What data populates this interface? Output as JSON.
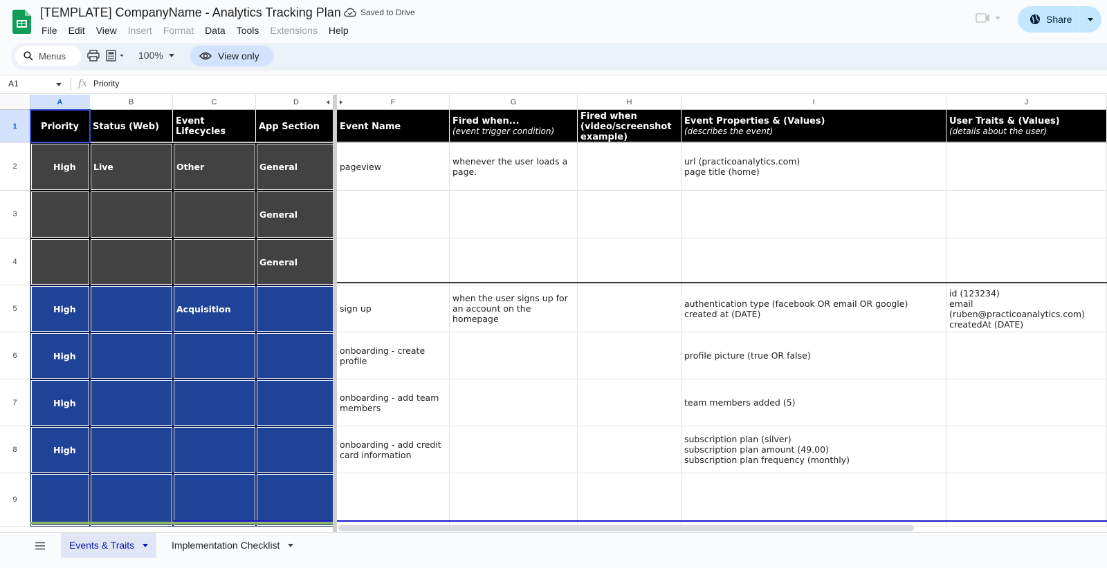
{
  "app": {
    "title": "[TEMPLATE] CompanyName - Analytics Tracking Plan",
    "save_status": "Saved to Drive",
    "brand_color": "#0f9d58"
  },
  "menu": [
    "File",
    "Edit",
    "View",
    "Insert",
    "Format",
    "Data",
    "Tools",
    "Extensions",
    "Help"
  ],
  "menu_disabled": [
    "Insert",
    "Format",
    "Extensions"
  ],
  "share": {
    "label": "Share",
    "color": "#c2e7ff"
  },
  "toolbar": {
    "search_label": "Menus",
    "zoom": "100%",
    "mode_label": "View only"
  },
  "formula_bar": {
    "cell_ref": "A1",
    "fx": "fx",
    "value": "Priority"
  },
  "columns": [
    "A",
    "B",
    "C",
    "D",
    "F",
    "G",
    "H",
    "I",
    "J"
  ],
  "rows": [
    "1",
    "2",
    "3",
    "4",
    "5",
    "6",
    "7",
    "8",
    "9"
  ],
  "header": {
    "priority": "Priority",
    "status": "Status (Web)",
    "lifecycle": "Event Lifecycles",
    "app_section": "App Section",
    "event_name": "Event Name",
    "fired_when": "Fired when...",
    "fired_when_sub": "(event trigger condition)",
    "fired_when_video": "Fired when (video/screenshot example)",
    "event_props": "Event Properties & (Values)",
    "event_props_sub": "(describes the event)",
    "user_traits": "User Traits & (Values)",
    "user_traits_sub": "(details about the user)"
  },
  "data_rows": [
    {
      "row": "2",
      "style": "dark",
      "priority": "High",
      "status": "Live",
      "lifecycle": "Other",
      "app_section": "General",
      "event_name": "pageview",
      "fired_when": "whenever the user loads a page.",
      "video": "",
      "props": "url (practicoanalytics.com)\npage title (home)",
      "traits": ""
    },
    {
      "row": "3",
      "style": "dark",
      "priority": "",
      "status": "",
      "lifecycle": "",
      "app_section": "General",
      "event_name": "",
      "fired_when": "",
      "video": "",
      "props": "",
      "traits": ""
    },
    {
      "row": "4",
      "style": "dark",
      "priority": "",
      "status": "",
      "lifecycle": "",
      "app_section": "General",
      "event_name": "",
      "fired_when": "",
      "video": "",
      "props": "",
      "traits": ""
    },
    {
      "row": "5",
      "style": "blue",
      "priority": "High",
      "status": "",
      "lifecycle": "Acquisition",
      "app_section": "",
      "event_name": "sign up",
      "fired_when": "when the user signs up for an account on the homepage",
      "video": "",
      "props": "authentication type (facebook OR email OR google)\ncreated at (DATE)",
      "traits": "id (123234)\nemail (ruben@practicoanalytics.com)\ncreatedAt (DATE)"
    },
    {
      "row": "6",
      "style": "blue",
      "priority": "High",
      "status": "",
      "lifecycle": "",
      "app_section": "",
      "event_name": "onboarding - create profile",
      "fired_when": "",
      "video": "",
      "props": "profile picture (true OR false)",
      "traits": ""
    },
    {
      "row": "7",
      "style": "blue",
      "priority": "High",
      "status": "",
      "lifecycle": "",
      "app_section": "",
      "event_name": "onboarding - add team members",
      "fired_when": "",
      "video": "",
      "props": "team members added (5)",
      "traits": ""
    },
    {
      "row": "8",
      "style": "blue",
      "priority": "High",
      "status": "",
      "lifecycle": "",
      "app_section": "",
      "event_name": "onboarding - add credit card information",
      "fired_when": "",
      "video": "",
      "props": "subscription plan (silver)\nsubscription plan amount (49.00)\nsubscription plan frequency (monthly)",
      "traits": ""
    },
    {
      "row": "9",
      "style": "blue",
      "priority": "",
      "status": "",
      "lifecycle": "",
      "app_section": "",
      "event_name": "",
      "fired_when": "",
      "video": "",
      "props": "",
      "traits": ""
    }
  ],
  "sheet_tabs": [
    {
      "label": "Events & Traits",
      "active": true
    },
    {
      "label": "Implementation Checklist",
      "active": false
    }
  ]
}
